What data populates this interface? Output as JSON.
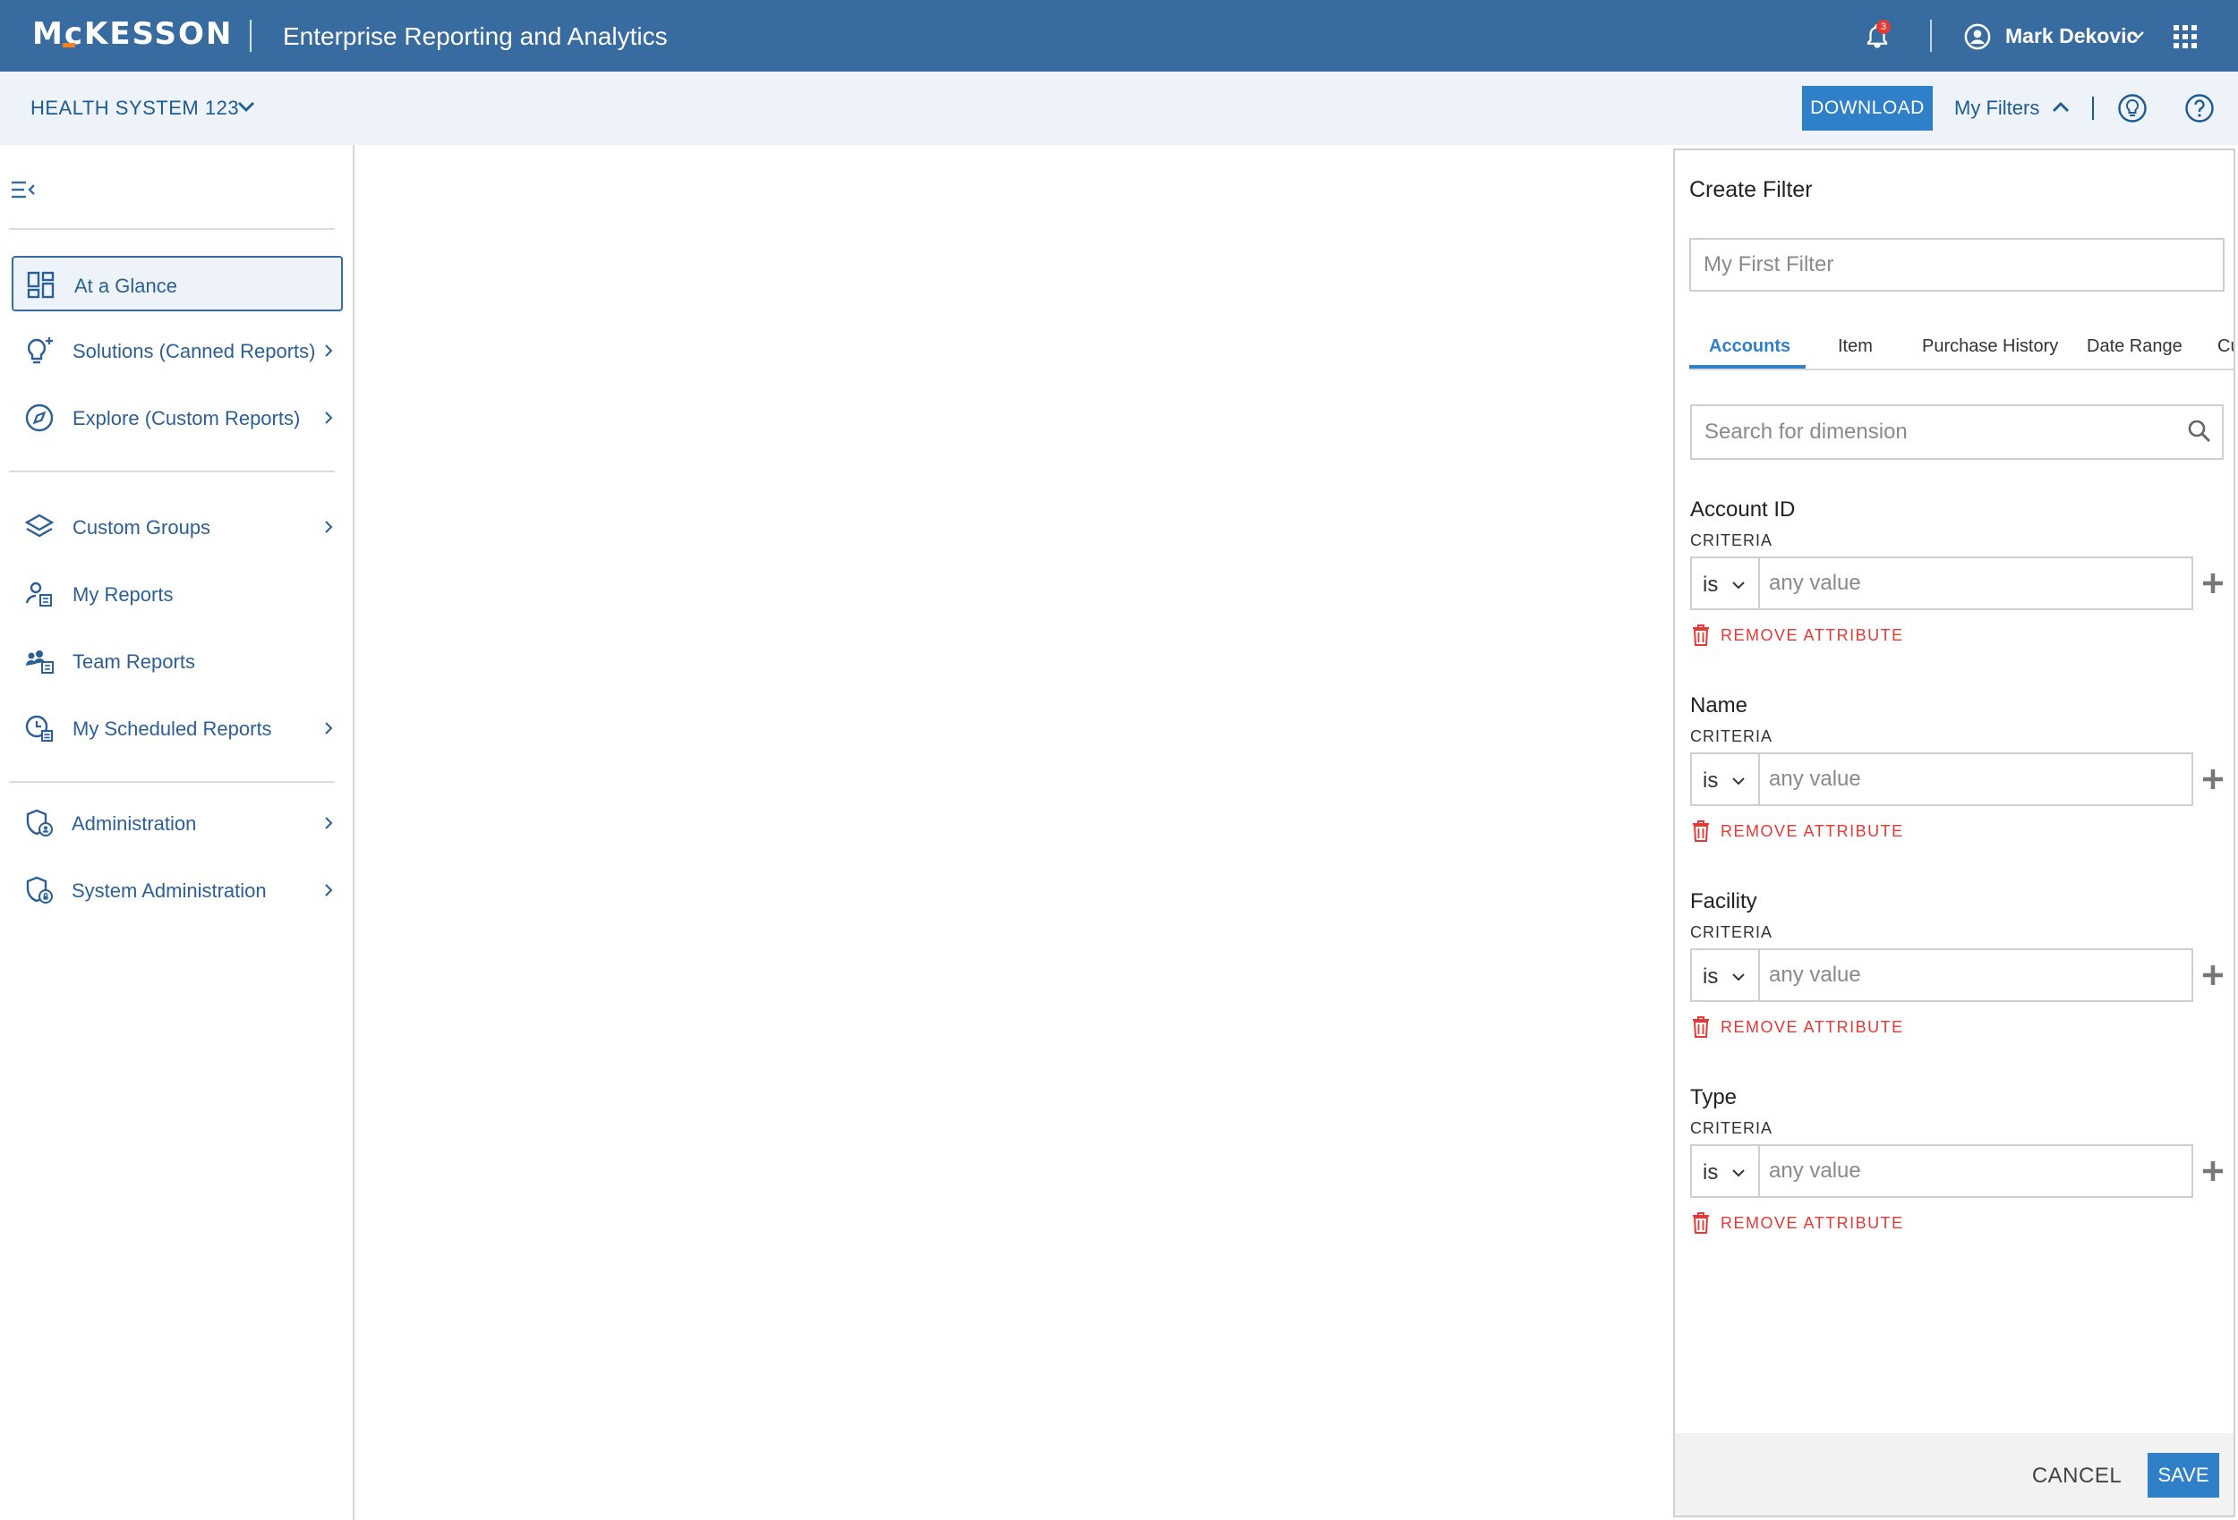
{
  "header": {
    "logo": "McKESSON",
    "app_title": "Enterprise Reporting and Analytics",
    "notification_count": "3",
    "user_name": "Mark Dekovic",
    "bar_color": "#386ba0"
  },
  "subheader": {
    "system_name": "HEALTH SYSTEM 123",
    "download_label": "DOWNLOAD",
    "my_filters_label": "My Filters"
  },
  "sidebar": {
    "items": [
      {
        "label": "At a Glance",
        "icon": "dashboard-icon",
        "active": true
      },
      {
        "label": "Solutions (Canned Reports)",
        "icon": "lightbulb-icon"
      },
      {
        "label": "Explore (Custom Reports)",
        "icon": "compass-icon"
      },
      {
        "label": "Custom Groups",
        "icon": "layers-icon"
      },
      {
        "label": "My Reports",
        "icon": "user-report-icon"
      },
      {
        "label": "Team Reports",
        "icon": "team-report-icon"
      },
      {
        "label": "My Scheduled Reports",
        "icon": "clock-report-icon"
      },
      {
        "label": "Administration",
        "icon": "shield-user-icon"
      },
      {
        "label": "System Administration",
        "icon": "shield-lock-icon"
      }
    ]
  },
  "filter_panel": {
    "title": "Create Filter",
    "name_placeholder": "My First Filter",
    "tabs": [
      "Accounts",
      "Item",
      "Purchase History",
      "Date Range",
      "Cu"
    ],
    "active_tab": "Accounts",
    "search_placeholder": "Search for dimension",
    "criteria_label": "CRITERIA",
    "operator": "is",
    "value_placeholder": "any value",
    "remove_label": "REMOVE ATTRIBUTE",
    "attributes": [
      "Account ID",
      "Name",
      "Facility",
      "Type"
    ],
    "cancel_label": "CANCEL",
    "save_label": "SAVE",
    "accent_color": "#2f80c9",
    "danger_color": "#e53935"
  }
}
